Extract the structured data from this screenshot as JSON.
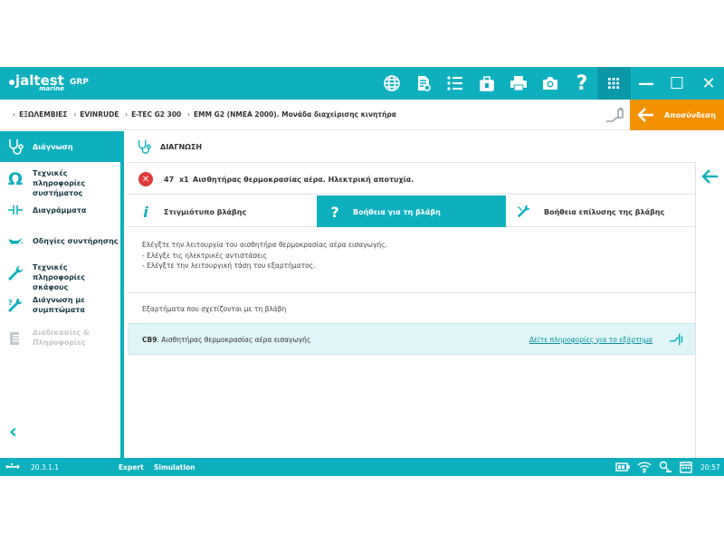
{
  "topbar": {
    "logo_main": "jaltest",
    "logo_sub": "marine",
    "product": "GRP",
    "icons": [
      "globe-icon",
      "document-search-icon",
      "list-icon",
      "battery-tester-icon",
      "printer-icon",
      "camera-icon",
      "help-icon",
      "apps-grid-icon"
    ],
    "help_glyph": "?",
    "window": {
      "minimize": "—",
      "maximize": "☐",
      "close": "✕"
    }
  },
  "breadcrumb": [
    "ΕΞΩΛΕΜΒΙΕΣ",
    "EVINRUDE",
    "E-TEC G2 300",
    "EMM G2 (NMEA 2000). Μονάδα διαχείρισης κινητήρα"
  ],
  "logout": {
    "label": "Αποσύνδεση"
  },
  "sidebar": {
    "items": [
      {
        "label": "Διάγνωση",
        "icon": "stethoscope-icon",
        "active": true
      },
      {
        "label": "Τεχνικές πληροφορίες συστήματος",
        "icon": "omega-icon"
      },
      {
        "label": "Διαγράμματα",
        "icon": "diagram-icon"
      },
      {
        "label": "Οδηγίες συντήρησης",
        "icon": "oil-can-icon"
      },
      {
        "label": "Τεχνικές πληροφορίες σκάφους",
        "icon": "wrench-icon"
      },
      {
        "label": "Διάγνωση με συμπτώματα",
        "icon": "symptoms-icon"
      },
      {
        "label": "Διαδικασίες & Πληροφορίες",
        "icon": "procedures-icon",
        "disabled": true
      }
    ],
    "back_glyph": "‹"
  },
  "main": {
    "header": "ΔΙΑΓΝΩΣΗ",
    "fault": {
      "code": "47",
      "count": "x1",
      "description": "Αισθητήρας θερμοκρασίας αέρα. Ηλεκτρική αποτυχία.",
      "icon_glyph": "✕"
    },
    "tabs": [
      {
        "label": "Στιγμιότυπο βλάβης",
        "glyph": "i"
      },
      {
        "label": "Βοήθεια για τη βλάβη",
        "glyph": "?",
        "active": true
      },
      {
        "label": "Βοήθεια επίλυσης της βλάβης",
        "glyph": ""
      }
    ],
    "help_lines": [
      "Ελέγξτε την λειτουργία του αισθητήρα θερμοκρασίας αέρα εισαγωγής.",
      "- Ελέγξε τις ηλεκτρικές αντιστάσεις",
      "- Ελέγξτε την λειτουργική τάση του εξαρτήματος."
    ],
    "related_title": "Εξαρτήματα που σχετίζονται με τη βλάβη",
    "related": {
      "code": "CB9",
      "name": ". Αισθητήρας θερμοκρασίας αέρα εισαγωγής",
      "link": "Δείτε πληροφορίες για το εξάρτημα"
    }
  },
  "statusbar": {
    "version": "20.3.1.1",
    "mode": "Expert",
    "sim": "Simulation",
    "time": "20:57"
  },
  "colors": {
    "accent": "#0fb0be",
    "logout": "#f39200",
    "error": "#e03a3a",
    "row_highlight": "#dff5f7"
  }
}
